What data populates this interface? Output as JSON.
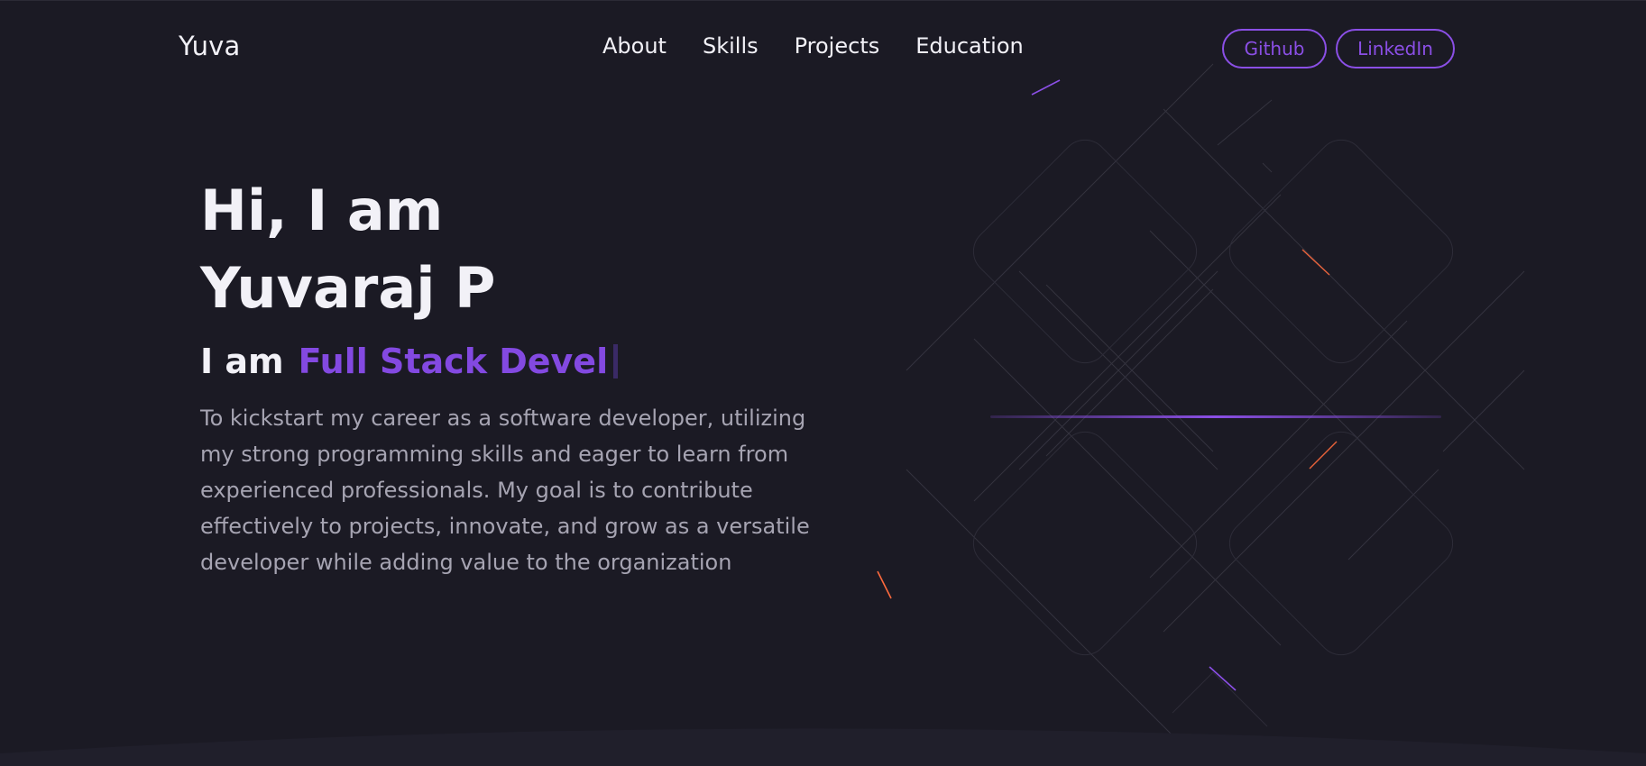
{
  "header": {
    "logo": "Yuva",
    "nav": [
      "About",
      "Skills",
      "Projects",
      "Education"
    ],
    "buttons": {
      "github": "Github",
      "linkedin": "LinkedIn"
    }
  },
  "hero": {
    "greeting": "Hi, I am",
    "name": "Yuvaraj P",
    "role_prefix": "I am",
    "role_typed": "Full Stack Devel",
    "objective": "To kickstart my career as a software developer, utilizing my strong programming skills and eager to learn from experienced professionals. My goal is to contribute effectively to projects, innovate, and grow as a versatile developer while adding value to the organization"
  },
  "colors": {
    "background": "#1b1a24",
    "accent": "#8b4fe6",
    "text": "#f2f1f7",
    "muted": "#a6a4b2",
    "spark_orange": "#ff6a3d"
  }
}
